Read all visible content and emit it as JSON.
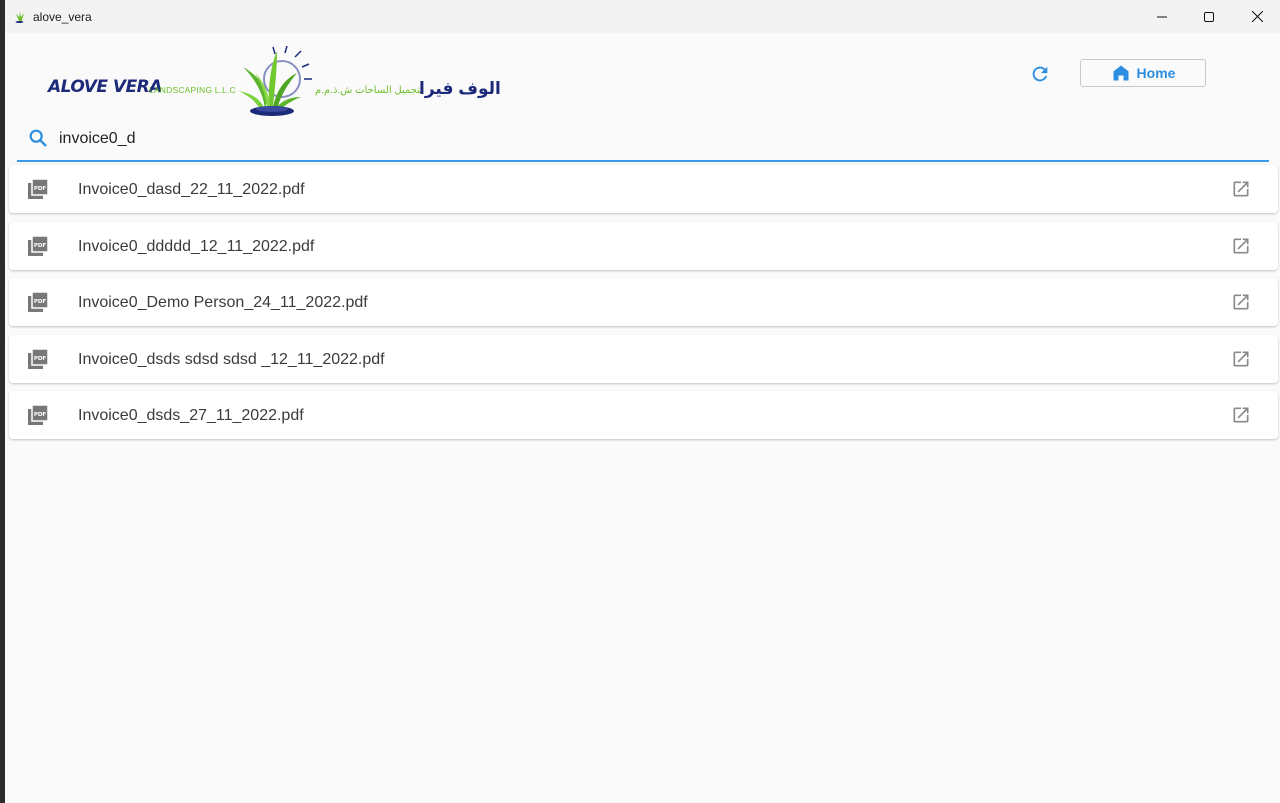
{
  "window": {
    "title": "alove_vera"
  },
  "header": {
    "logo_en_main": "ALOVE VERA",
    "logo_en_sub": "LANDSCAPING L.L.C",
    "logo_ar_main": "الوف فيرا",
    "logo_ar_sub": "لتجميل الساحات ش.ذ.م.م",
    "home_label": "Home"
  },
  "search": {
    "value": "invoice0_d"
  },
  "files": [
    {
      "name": "Invoice0_dasd_22_11_2022.pdf"
    },
    {
      "name": "Invoice0_ddddd_12_11_2022.pdf"
    },
    {
      "name": "Invoice0_Demo Person_24_11_2022.pdf"
    },
    {
      "name": "Invoice0_dsds sdsd sdsd _12_11_2022.pdf"
    },
    {
      "name": "Invoice0_dsds_27_11_2022.pdf"
    }
  ],
  "colors": {
    "accent": "#3a9aea",
    "logo_blue": "#1d2a7a",
    "logo_green": "#6fbf2a"
  }
}
